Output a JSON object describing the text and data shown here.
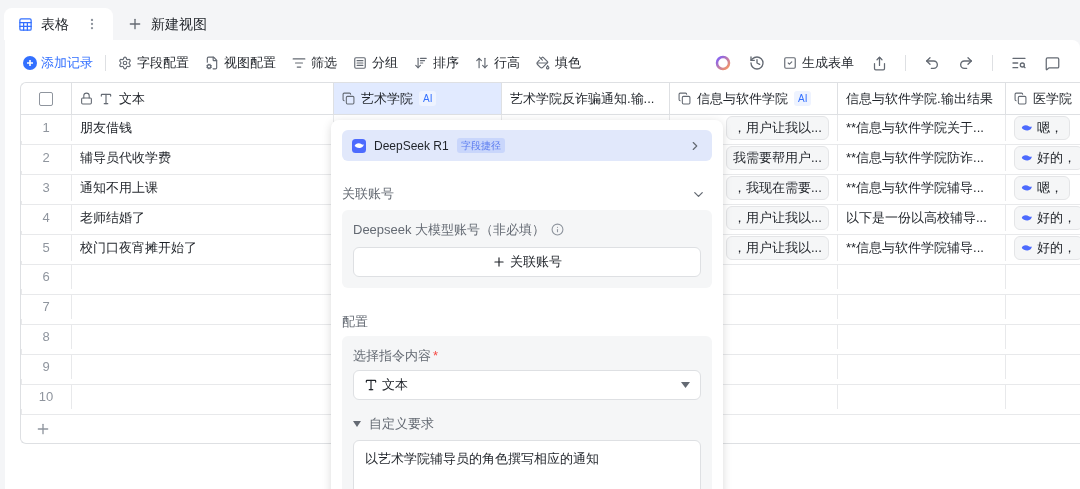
{
  "view_tabs": [
    {
      "label": "表格",
      "selected": true
    },
    {
      "label": "新建视图",
      "selected": false
    }
  ],
  "toolbar": {
    "add_record": "添加记录",
    "tools": [
      {
        "kind": "settings",
        "label": "字段配置"
      },
      {
        "kind": "view",
        "label": "视图配置"
      },
      {
        "kind": "filter",
        "label": "筛选"
      },
      {
        "kind": "group",
        "label": "分组"
      },
      {
        "kind": "sort",
        "label": "排序"
      },
      {
        "kind": "height",
        "label": "行高"
      },
      {
        "kind": "fill",
        "label": "填色"
      }
    ],
    "generate_form": "生成表单"
  },
  "table": {
    "select_all": {
      "checked": false
    },
    "columns": [
      {
        "label": "文本",
        "kind": "text",
        "selected": false
      },
      {
        "label": "艺术学院",
        "kind": "ai",
        "badge": "AI",
        "selected": true
      },
      {
        "label": "艺术学院反诈骗通知.输...",
        "kind": "plain",
        "selected": false
      },
      {
        "label": "信息与软件学院",
        "kind": "ai",
        "badge": "AI",
        "selected": false
      },
      {
        "label": "信息与软件学院.输出结果",
        "kind": "plain",
        "selected": false
      },
      {
        "label": "医学院",
        "kind": "ai",
        "selected": false
      }
    ],
    "rows": [
      {
        "number": "1",
        "text": "朋友借钱",
        "column_4": "，用户让我以...",
        "column_5": "**信息与软件学院关于...",
        "column_6": "嗯，"
      },
      {
        "number": "2",
        "text": "辅导员代收学费",
        "column_4": "我需要帮用户...",
        "column_5": "**信息与软件学院防诈...",
        "column_6": "好的，"
      },
      {
        "number": "3",
        "text": "通知不用上课",
        "column_4": "，我现在需要...",
        "column_5": "**信息与软件学院辅导...",
        "column_6": "嗯，"
      },
      {
        "number": "4",
        "text": "老师结婚了",
        "column_4": "，用户让我以...",
        "column_5": "以下是一份以高校辅导...",
        "column_6": "好的，"
      },
      {
        "number": "5",
        "text": "校门口夜宵摊开始了",
        "column_4": "，用户让我以...",
        "column_5": "**信息与软件学院辅导...",
        "column_6": "好的，"
      },
      {
        "number": "6"
      },
      {
        "number": "7"
      },
      {
        "number": "8"
      },
      {
        "number": "9"
      },
      {
        "number": "10"
      }
    ]
  },
  "field_panel": {
    "model": {
      "name": "DeepSeek R1",
      "tag": "字段捷径"
    },
    "account_section": {
      "title": "关联账号",
      "expanded": true,
      "field_label": "Deepseek 大模型账号（非必填）",
      "button": "关联账号"
    },
    "config_section": {
      "title": "配置",
      "instruction_label": "选择指令内容",
      "required_mark": "*",
      "instruction_value": "文本",
      "custom": {
        "label": "自定义要求",
        "expanded": true,
        "value": "以艺术学院辅导员的角色撰写相应的通知"
      }
    }
  }
}
